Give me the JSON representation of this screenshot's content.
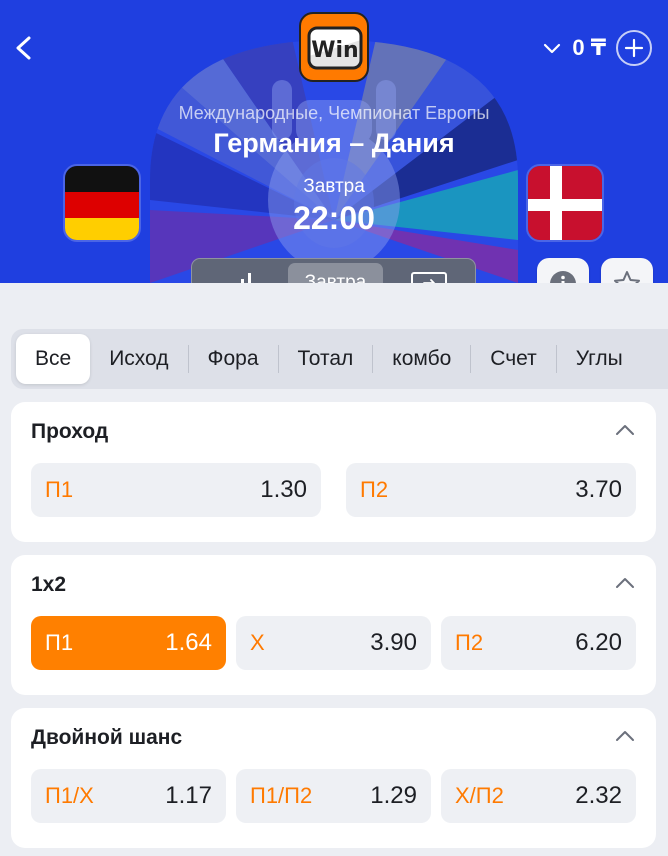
{
  "header": {
    "logo_text": "Win",
    "balance": "0 ₸",
    "tournament": "Международные, Чемпионат Европы",
    "match_title": "Германия – Дания",
    "day": "Завтра",
    "time": "22:00",
    "segment": {
      "stats_icon": "signal-bars-icon",
      "tomorrow_label": "Завтра",
      "tv_icon": "tv-screen-icon"
    },
    "colors": {
      "background": "#1f3fe0",
      "accent": "#ff7a00"
    }
  },
  "teams": {
    "home": {
      "flag": "germany-flag"
    },
    "away": {
      "flag": "denmark-flag"
    }
  },
  "tabs": [
    {
      "label": "Все",
      "active": true
    },
    {
      "label": "Исход"
    },
    {
      "label": "Фора"
    },
    {
      "label": "Тотал"
    },
    {
      "label": "комбо"
    },
    {
      "label": "Счет"
    },
    {
      "label": "Углы"
    }
  ],
  "markets": [
    {
      "title": "Проход",
      "odds": [
        {
          "label": "П1",
          "value": "1.30"
        },
        {
          "label": "П2",
          "value": "3.70"
        }
      ]
    },
    {
      "title": "1х2",
      "odds": [
        {
          "label": "П1",
          "value": "1.64",
          "selected": true
        },
        {
          "label": "Х",
          "value": "3.90"
        },
        {
          "label": "П2",
          "value": "6.20"
        }
      ]
    },
    {
      "title": "Двойной шанс",
      "odds": [
        {
          "label": "П1/Х",
          "value": "1.17"
        },
        {
          "label": "П1/П2",
          "value": "1.29"
        },
        {
          "label": "Х/П2",
          "value": "2.32"
        }
      ]
    }
  ]
}
